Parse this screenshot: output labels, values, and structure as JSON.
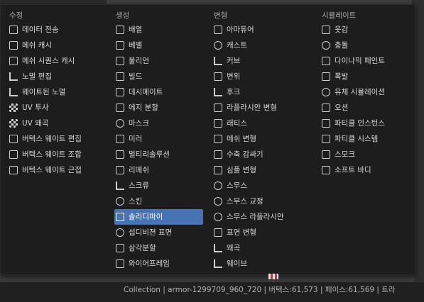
{
  "columns": [
    {
      "header": "수정",
      "items": [
        {
          "label": "데이터 전송",
          "icon": "transfer-icon"
        },
        {
          "label": "메쉬 캐시",
          "icon": "mesh-cache-icon"
        },
        {
          "label": "메쉬 시퀀스 캐시",
          "icon": "mesh-sequence-icon"
        },
        {
          "label": "노멀 편집",
          "icon": "normal-edit-icon"
        },
        {
          "label": "웨이트된 노멀",
          "icon": "weighted-normal-icon"
        },
        {
          "label": "UV 투사",
          "icon": "uv-project-icon"
        },
        {
          "label": "UV 왜곡",
          "icon": "uv-warp-icon"
        },
        {
          "label": "버텍스 웨이트 편집",
          "icon": "vertex-weight-edit-icon"
        },
        {
          "label": "버텍스 웨이트 조합",
          "icon": "vertex-weight-mix-icon"
        },
        {
          "label": "버텍스 웨이트 근접",
          "icon": "vertex-weight-proximity-icon"
        }
      ]
    },
    {
      "header": "생성",
      "items": [
        {
          "label": "배열",
          "icon": "array-icon"
        },
        {
          "label": "베벨",
          "icon": "bevel-icon"
        },
        {
          "label": "불리언",
          "icon": "boolean-icon"
        },
        {
          "label": "빌드",
          "icon": "build-icon"
        },
        {
          "label": "데시메이트",
          "icon": "decimate-icon"
        },
        {
          "label": "에지 분할",
          "icon": "edge-split-icon"
        },
        {
          "label": "마스크",
          "icon": "mask-icon"
        },
        {
          "label": "미러",
          "icon": "mirror-icon"
        },
        {
          "label": "멀티리솔루션",
          "icon": "multires-icon"
        },
        {
          "label": "리메쉬",
          "icon": "remesh-icon"
        },
        {
          "label": "스크류",
          "icon": "screw-icon"
        },
        {
          "label": "스킨",
          "icon": "skin-icon"
        },
        {
          "label": "솔리디파이",
          "icon": "solidify-icon",
          "active": true
        },
        {
          "label": "섭디비젼 표면",
          "icon": "subsurf-icon"
        },
        {
          "label": "삼각분할",
          "icon": "triangulate-icon"
        },
        {
          "label": "와이어프레임",
          "icon": "wireframe-icon"
        }
      ]
    },
    {
      "header": "변형",
      "items": [
        {
          "label": "아마튜어",
          "icon": "armature-icon"
        },
        {
          "label": "캐스트",
          "icon": "cast-icon"
        },
        {
          "label": "커브",
          "icon": "curve-icon"
        },
        {
          "label": "변위",
          "icon": "displace-icon"
        },
        {
          "label": "후크",
          "icon": "hook-icon"
        },
        {
          "label": "라플라시안 변형",
          "icon": "laplacian-deform-icon"
        },
        {
          "label": "래티스",
          "icon": "lattice-icon"
        },
        {
          "label": "메쉬 변형",
          "icon": "mesh-deform-icon"
        },
        {
          "label": "수축 감싸기",
          "icon": "shrinkwrap-icon"
        },
        {
          "label": "심플 변형",
          "icon": "simple-deform-icon"
        },
        {
          "label": "스무스",
          "icon": "smooth-icon"
        },
        {
          "label": "스무스 교정",
          "icon": "corrective-smooth-icon"
        },
        {
          "label": "스무스 라플라시안",
          "icon": "laplacian-smooth-icon"
        },
        {
          "label": "표면 변형",
          "icon": "surface-deform-icon"
        },
        {
          "label": "왜곡",
          "icon": "warp-icon"
        },
        {
          "label": "웨이브",
          "icon": "wave-icon"
        }
      ]
    },
    {
      "header": "시뮬레이트",
      "items": [
        {
          "label": "옷감",
          "icon": "cloth-icon"
        },
        {
          "label": "충돌",
          "icon": "collision-icon"
        },
        {
          "label": "다이나믹 페인트",
          "icon": "dynamic-paint-icon"
        },
        {
          "label": "폭발",
          "icon": "explode-icon"
        },
        {
          "label": "유체 시뮬레이션",
          "icon": "fluid-icon"
        },
        {
          "label": "오션",
          "icon": "ocean-icon"
        },
        {
          "label": "파티클 인스턴스",
          "icon": "particle-instance-icon"
        },
        {
          "label": "파티클 시스템",
          "icon": "particle-system-icon"
        },
        {
          "label": "스모크",
          "icon": "smoke-icon"
        },
        {
          "label": "소프트 바디",
          "icon": "soft-body-icon"
        }
      ]
    }
  ],
  "statusbar": {
    "text": "Collection | armor-1299709_960_720 | 버텍스:61,573 | 페이스:61,569 | 트라"
  }
}
